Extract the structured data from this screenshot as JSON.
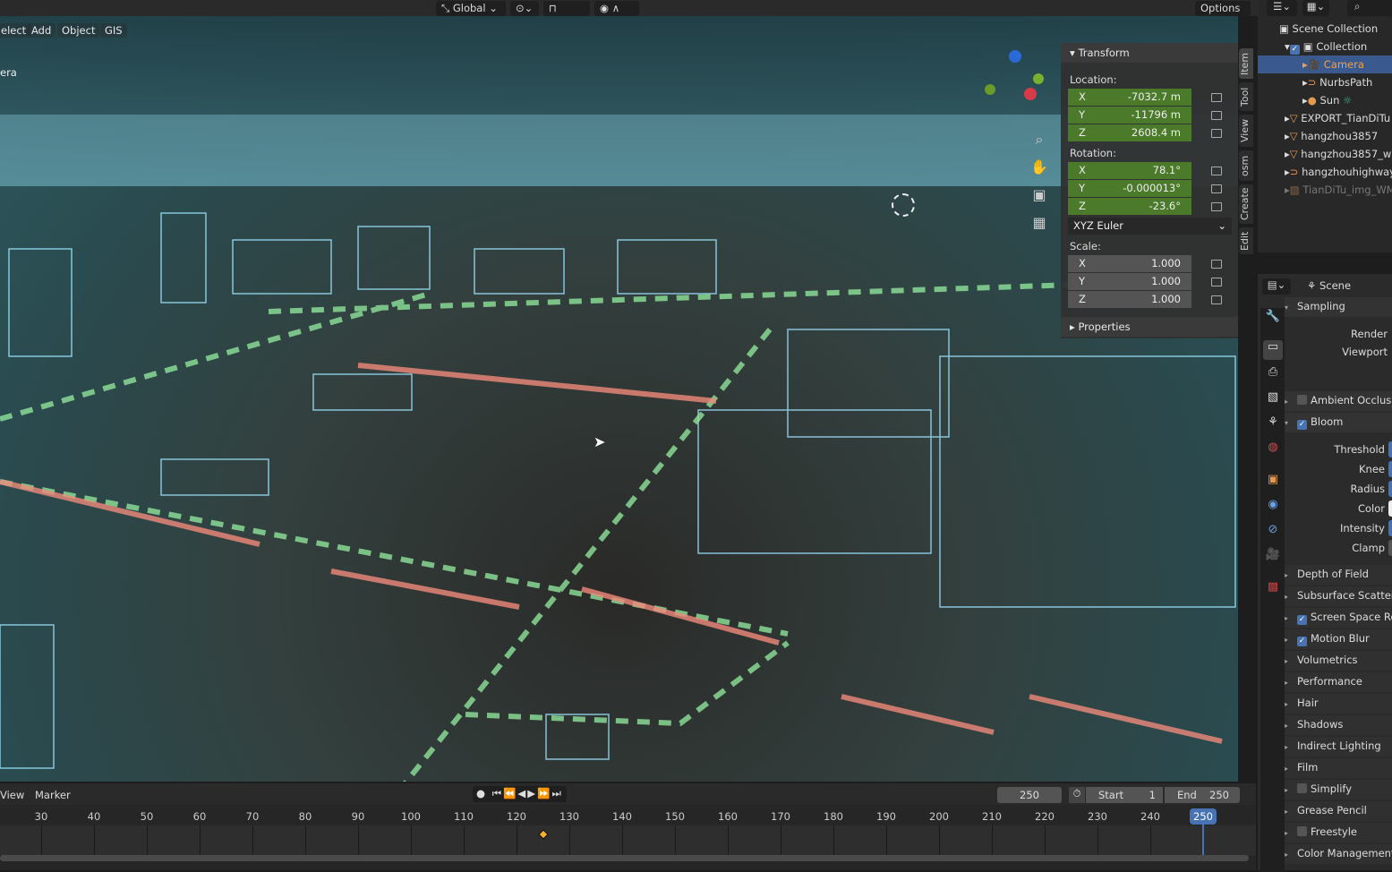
{
  "header": {
    "orientation": "Global",
    "options": "Options"
  },
  "viewport": {
    "menus": [
      "elect",
      "Add",
      "Object",
      "GIS"
    ],
    "camera_label": "era"
  },
  "npanel": {
    "transform": "Transform",
    "location_label": "Location:",
    "location": [
      {
        "axis": "X",
        "value": "-7032.7 m"
      },
      {
        "axis": "Y",
        "value": "-11796 m"
      },
      {
        "axis": "Z",
        "value": "2608.4 m"
      }
    ],
    "rotation_label": "Rotation:",
    "rotation": [
      {
        "axis": "X",
        "value": "78.1°"
      },
      {
        "axis": "Y",
        "value": "-0.000013°"
      },
      {
        "axis": "Z",
        "value": "-23.6°"
      }
    ],
    "rotation_mode": "XYZ Euler",
    "scale_label": "Scale:",
    "scale": [
      {
        "axis": "X",
        "value": "1.000"
      },
      {
        "axis": "Y",
        "value": "1.000"
      },
      {
        "axis": "Z",
        "value": "1.000"
      }
    ],
    "properties": "Properties",
    "tabs": [
      "Item",
      "Tool",
      "View",
      "osm",
      "Create",
      "Edit"
    ]
  },
  "outliner": {
    "items": [
      "Scene Collection",
      "Collection",
      "Camera",
      "NurbsPath",
      "Sun",
      "EXPORT_TianDiTu",
      "hangzhou3857",
      "hangzhou3857_w",
      "hangzhouhighway",
      "TianDiTu_img_WM"
    ]
  },
  "properties": {
    "context": "Scene",
    "sampling": "Sampling",
    "render": "Render",
    "viewport": "Viewport",
    "ambient": "Ambient Occlusion",
    "bloom": "Bloom",
    "bloom_fields": [
      "Threshold",
      "Knee",
      "Radius",
      "Color",
      "Intensity",
      "Clamp"
    ],
    "panels": [
      {
        "label": "Depth of Field"
      },
      {
        "label": "Subsurface Scattering"
      },
      {
        "label": "Screen Space Reflections",
        "check": true
      },
      {
        "label": "Motion Blur",
        "check": true
      },
      {
        "label": "Volumetrics"
      },
      {
        "label": "Performance"
      },
      {
        "label": "Hair"
      },
      {
        "label": "Shadows"
      },
      {
        "label": "Indirect Lighting"
      },
      {
        "label": "Film"
      },
      {
        "label": "Simplify",
        "check": false
      },
      {
        "label": "Grease Pencil"
      },
      {
        "label": "Freestyle",
        "check": false
      },
      {
        "label": "Color Management"
      }
    ]
  },
  "timeline": {
    "menus": [
      "View",
      "Marker"
    ],
    "current_frame": "250",
    "start_label": "Start",
    "start": "1",
    "end_label": "End",
    "end": "250",
    "ticks": [
      "30",
      "40",
      "50",
      "60",
      "70",
      "80",
      "90",
      "100",
      "110",
      "120",
      "130",
      "140",
      "150",
      "160",
      "170",
      "180",
      "190",
      "200",
      "210",
      "220",
      "230",
      "240"
    ],
    "playhead": "250",
    "keyframe": 125
  }
}
